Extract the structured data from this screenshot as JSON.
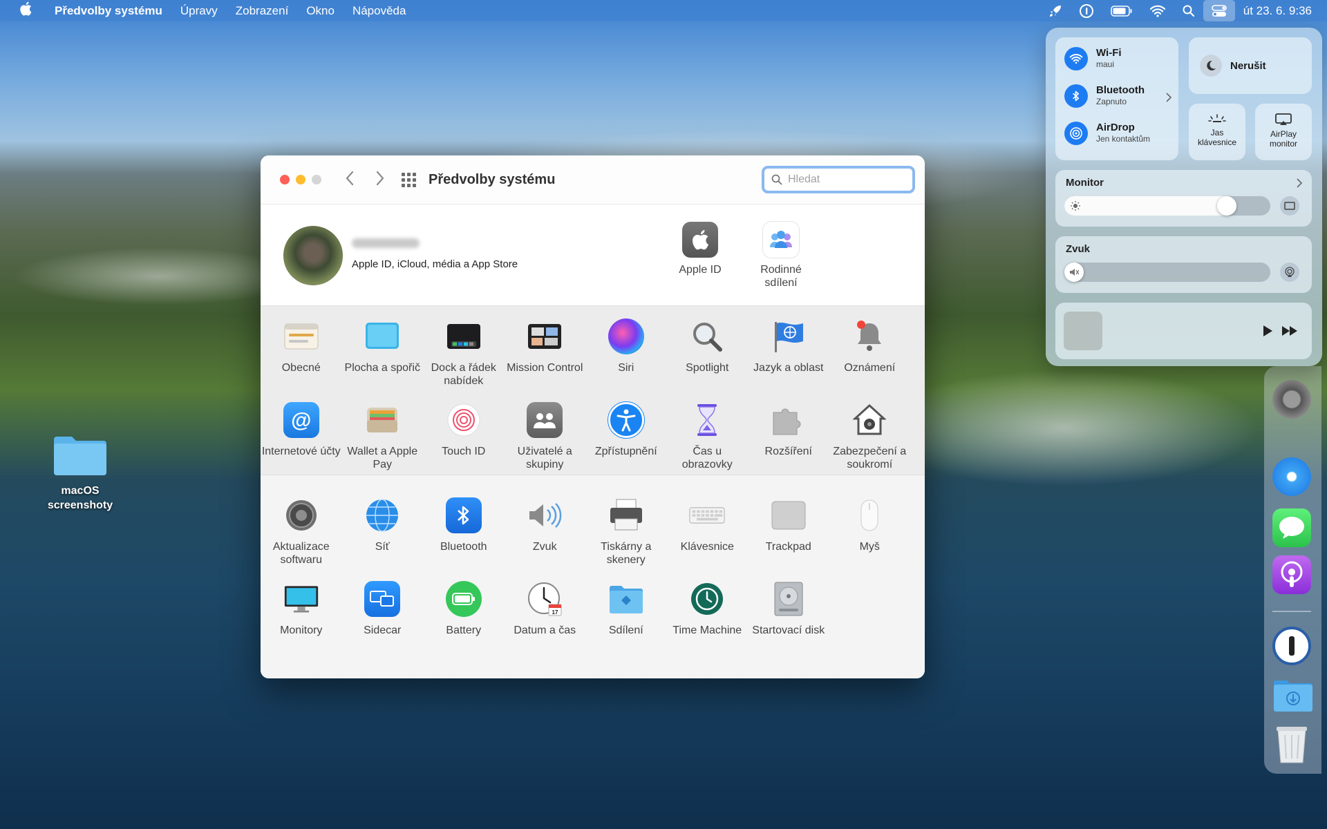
{
  "menubar": {
    "app_name": "Předvolby systému",
    "menus": [
      "Úpravy",
      "Zobrazení",
      "Okno",
      "Nápověda"
    ],
    "clock": "út 23. 6.  9:36"
  },
  "desktop": {
    "folder_label": "macOS screenshoty"
  },
  "window": {
    "title": "Předvolby systému",
    "search_placeholder": "Hledat",
    "account_label": "Apple ID, iCloud, média a App Store",
    "top_items": [
      {
        "label": "Apple ID",
        "icon": "apple-id-icon"
      },
      {
        "label": "Rodinné sdílení",
        "icon": "family-sharing-icon"
      }
    ],
    "section1": [
      {
        "label": "Obecné",
        "icon": "general-icon"
      },
      {
        "label": "Plocha a spořič",
        "icon": "desktop-screensaver-icon"
      },
      {
        "label": "Dock a řádek nabídek",
        "icon": "dock-icon"
      },
      {
        "label": "Mission Control",
        "icon": "mission-control-icon"
      },
      {
        "label": "Siri",
        "icon": "siri-icon"
      },
      {
        "label": "Spotlight",
        "icon": "spotlight-icon"
      },
      {
        "label": "Jazyk a oblast",
        "icon": "language-region-icon"
      },
      {
        "label": "Oznámení",
        "icon": "notifications-icon"
      },
      {
        "label": "Internetové účty",
        "icon": "internet-accounts-icon"
      },
      {
        "label": "Wallet a Apple Pay",
        "icon": "wallet-icon"
      },
      {
        "label": "Touch ID",
        "icon": "touch-id-icon"
      },
      {
        "label": "Uživatelé a skupiny",
        "icon": "users-groups-icon"
      },
      {
        "label": "Zpřístupnění",
        "icon": "accessibility-icon"
      },
      {
        "label": "Čas u obrazovky",
        "icon": "screen-time-icon"
      },
      {
        "label": "Rozšíření",
        "icon": "extensions-icon"
      },
      {
        "label": "Zabezpečení a soukromí",
        "icon": "security-privacy-icon"
      }
    ],
    "section2": [
      {
        "label": "Aktualizace softwaru",
        "icon": "software-update-icon"
      },
      {
        "label": "Síť",
        "icon": "network-icon"
      },
      {
        "label": "Bluetooth",
        "icon": "bluetooth-icon"
      },
      {
        "label": "Zvuk",
        "icon": "sound-icon"
      },
      {
        "label": "Tiskárny a skenery",
        "icon": "printers-icon"
      },
      {
        "label": "Klávesnice",
        "icon": "keyboard-icon"
      },
      {
        "label": "Trackpad",
        "icon": "trackpad-icon"
      },
      {
        "label": "Myš",
        "icon": "mouse-icon"
      },
      {
        "label": "Monitory",
        "icon": "displays-icon"
      },
      {
        "label": "Sidecar",
        "icon": "sidecar-icon"
      },
      {
        "label": "Battery",
        "icon": "battery-icon"
      },
      {
        "label": "Datum a čas",
        "icon": "date-time-icon"
      },
      {
        "label": "Sdílení",
        "icon": "sharing-icon"
      },
      {
        "label": "Time Machine",
        "icon": "time-machine-icon"
      },
      {
        "label": "Startovací disk",
        "icon": "startup-disk-icon"
      }
    ]
  },
  "control_center": {
    "wifi": {
      "title": "Wi-Fi",
      "sub": "maui"
    },
    "bluetooth": {
      "title": "Bluetooth",
      "sub": "Zapnuto"
    },
    "airdrop": {
      "title": "AirDrop",
      "sub": "Jen kontaktům"
    },
    "dnd": "Nerušit",
    "keyboard_brightness": "Jas klávesnice",
    "airplay": "AirPlay monitor",
    "monitor_title": "Monitor",
    "monitor_level": 0.82,
    "sound_title": "Zvuk",
    "sound_level": 0.0
  },
  "dock_apps": [
    "system-preferences-icon",
    "safari-icon",
    "messages-icon",
    "podcasts-icon",
    "1password-icon",
    "downloads-icon",
    "trash-icon"
  ]
}
